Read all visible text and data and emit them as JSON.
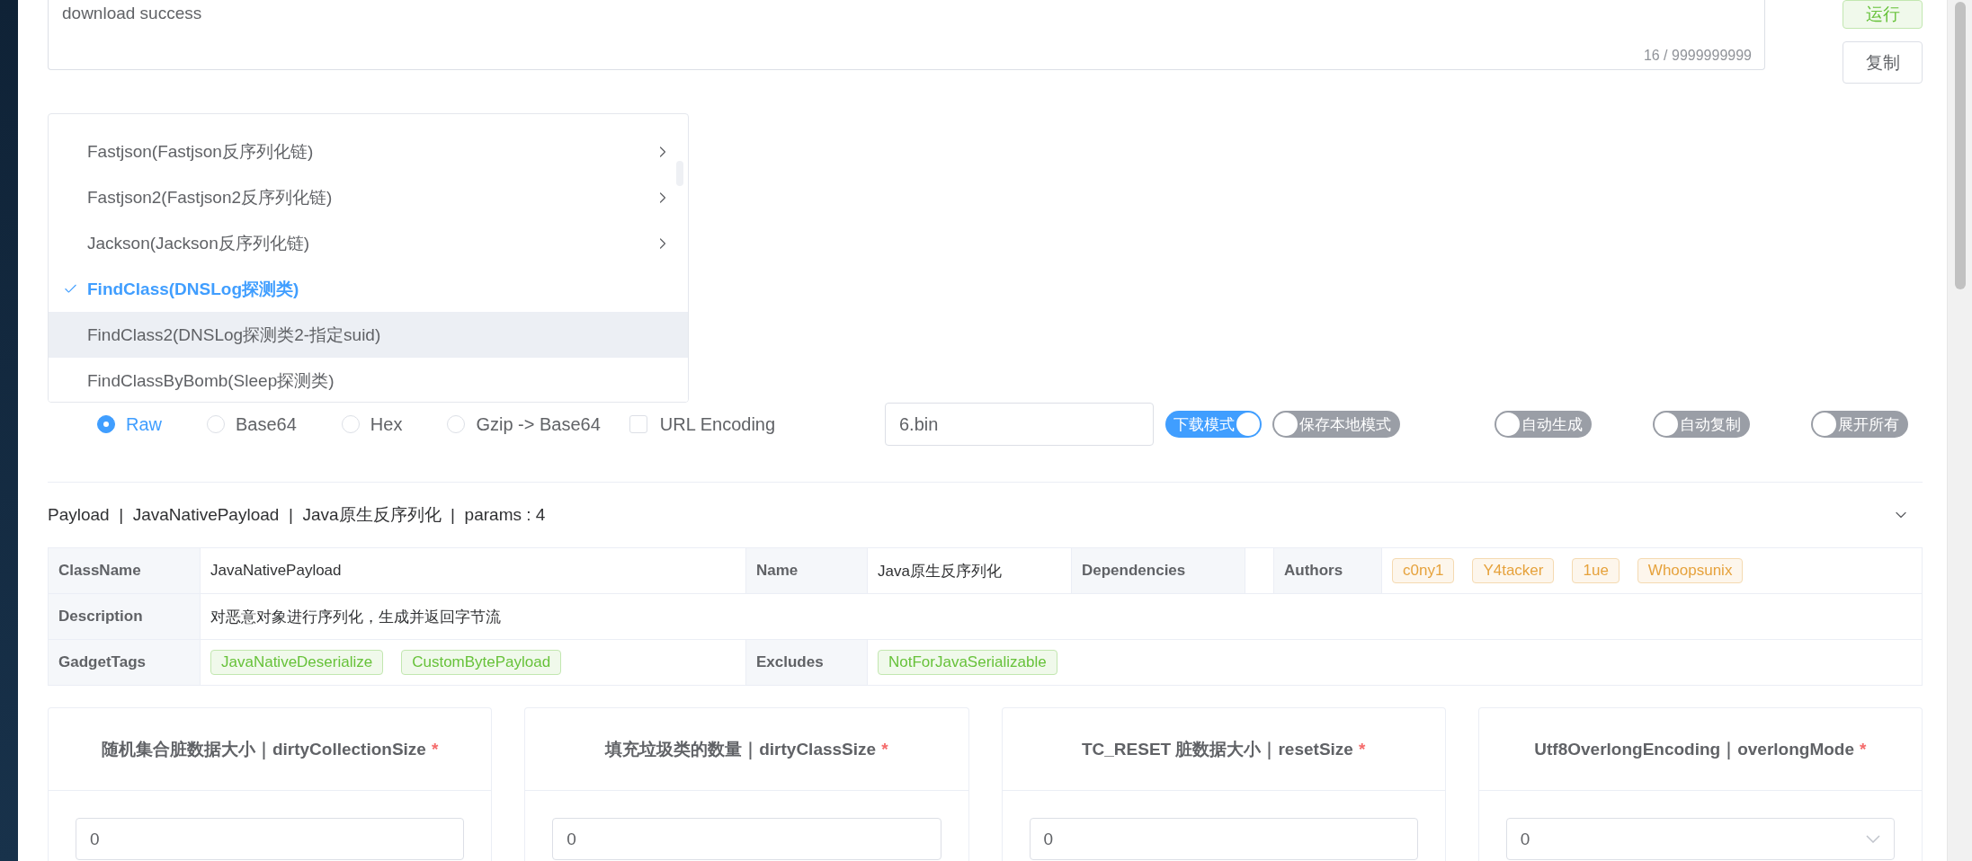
{
  "output": {
    "value": "download success",
    "counter": "16 / 9999999999"
  },
  "buttons": [
    {
      "label": "运行",
      "kind": "run"
    },
    {
      "label": "复制",
      "kind": "plain"
    }
  ],
  "menu": {
    "items": [
      {
        "label": "Fastjson(Fastjson反序列化链)",
        "selected": false,
        "highlighted": false,
        "has_children": true
      },
      {
        "label": "Fastjson2(Fastjson2反序列化链)",
        "selected": false,
        "highlighted": false,
        "has_children": true
      },
      {
        "label": "Jackson(Jackson反序列化链)",
        "selected": false,
        "highlighted": false,
        "has_children": true
      },
      {
        "label": "FindClass(DNSLog探测类)",
        "selected": true,
        "highlighted": false,
        "has_children": false
      },
      {
        "label": "FindClass2(DNSLog探测类2-指定suid)",
        "selected": false,
        "highlighted": true,
        "has_children": false
      },
      {
        "label": "FindClassByBomb(Sleep探测类)",
        "selected": false,
        "highlighted": false,
        "has_children": false
      }
    ]
  },
  "encodings": [
    {
      "label": "Raw",
      "selected": true
    },
    {
      "label": "Base64",
      "selected": false
    },
    {
      "label": "Hex",
      "selected": false
    },
    {
      "label": "Gzip -> Base64",
      "selected": false
    }
  ],
  "url_encoding": {
    "label": "URL Encoding",
    "checked": false
  },
  "filename": {
    "value": "6.bin"
  },
  "switches": [
    {
      "label": "下载模式",
      "on": true
    },
    {
      "label": "保存本地模式",
      "on": false
    },
    {
      "label": "自动生成",
      "on": false
    },
    {
      "label": "自动复制",
      "on": false
    },
    {
      "label": "展开所有",
      "on": false
    }
  ],
  "payload_header": {
    "parts": [
      "Payload",
      "JavaNativePayload",
      "Java原生反序列化",
      "params : 4"
    ],
    "separator": "|",
    "expanded": true
  },
  "details": {
    "class_name": {
      "label": "ClassName",
      "value": "JavaNativePayload"
    },
    "name": {
      "label": "Name",
      "value": "Java原生反序列化"
    },
    "dependencies": {
      "label": "Dependencies"
    },
    "authors": {
      "label": "Authors",
      "tags": [
        "c0ny1",
        "Y4tacker",
        "1ue",
        "Whoopsunix"
      ]
    },
    "description": {
      "label": "Description",
      "value": "对恶意对象进行序列化，生成并返回字节流"
    },
    "gadget_tags": {
      "label": "GadgetTags",
      "tags": [
        "JavaNativeDeserialize",
        "CustomBytePayload"
      ]
    },
    "excludes": {
      "label": "Excludes",
      "tags": [
        "NotForJavaSerializable"
      ]
    }
  },
  "params": [
    {
      "title": "随机集合脏数据大小｜dirtyCollectionSize",
      "required": "*",
      "value": "0",
      "kind": "input"
    },
    {
      "title": "填充垃圾类的数量｜dirtyClassSize",
      "required": "*",
      "value": "0",
      "kind": "input"
    },
    {
      "title": "TC_RESET 脏数据大小｜resetSize",
      "required": "*",
      "value": "0",
      "kind": "input"
    },
    {
      "title": "Utf8OverlongEncoding｜overlongMode",
      "required": "*",
      "value": "0",
      "kind": "select"
    }
  ]
}
